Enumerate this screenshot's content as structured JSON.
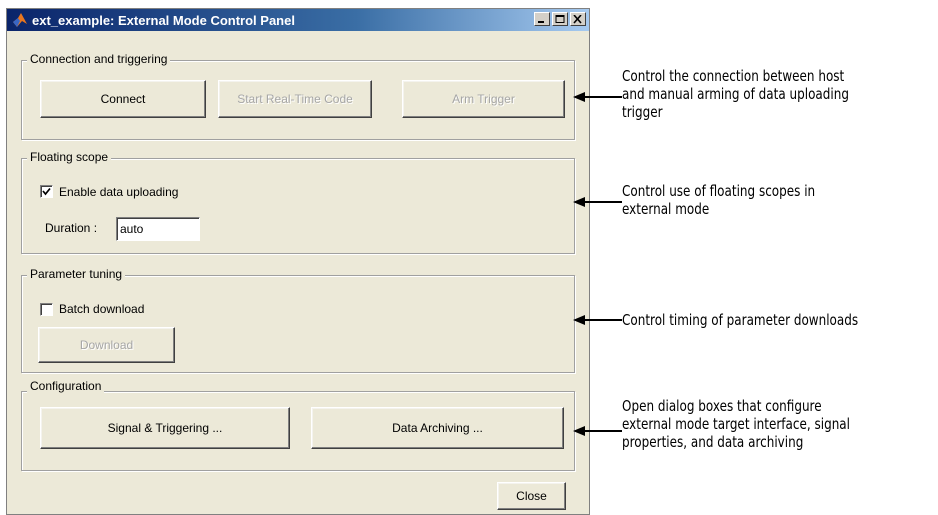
{
  "window": {
    "title": "ext_example: External Mode Control Panel"
  },
  "connection": {
    "legend": "Connection and triggering",
    "connect_label": "Connect",
    "start_label": "Start Real-Time Code",
    "arm_label": "Arm Trigger"
  },
  "scope": {
    "legend": "Floating scope",
    "enable_label": "Enable data uploading",
    "enable_checked": true,
    "duration_label": "Duration :",
    "duration_value": "auto"
  },
  "tuning": {
    "legend": "Parameter tuning",
    "batch_label": "Batch download",
    "batch_checked": false,
    "download_label": "Download"
  },
  "configuration": {
    "legend": "Configuration",
    "signal_label": "Signal & Triggering ...",
    "archiving_label": "Data Archiving ..."
  },
  "close_label": "Close",
  "annotations": {
    "connection": [
      "Control the connection between host",
      "and manual arming of data uploading",
      "trigger"
    ],
    "scope": [
      "Control use of floating scopes in",
      "external mode"
    ],
    "tuning": [
      "Control timing of parameter downloads"
    ],
    "configuration": [
      "Open dialog boxes that configure",
      "external mode target interface, signal",
      "properties, and data archiving"
    ]
  },
  "icons": {
    "app": "matlab-logo-icon",
    "minimize": "minimize-icon",
    "maximize": "maximize-icon",
    "close": "close-icon",
    "check": "checkmark-icon",
    "arrow": "left-arrow-icon"
  },
  "colors": {
    "titlebar_start": "#0a246a",
    "titlebar_end": "#a6caf0",
    "panel_bg": "#ece9d8"
  }
}
